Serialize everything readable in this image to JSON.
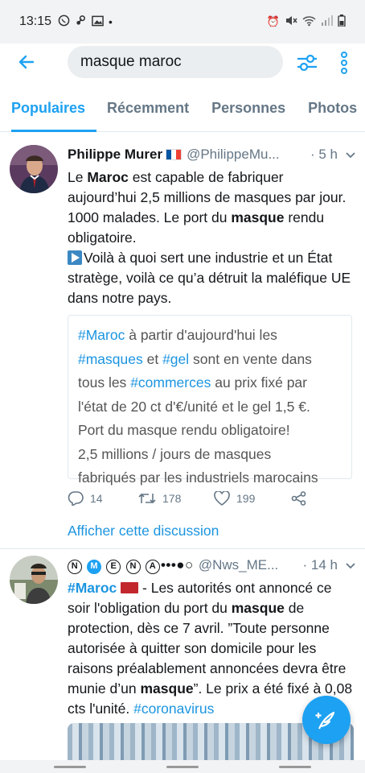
{
  "status_bar": {
    "time": "13:15",
    "left_icons": [
      "whatsapp-icon",
      "steam-icon",
      "gallery-icon",
      "dot-icon"
    ],
    "right_icons": [
      "alarm-icon",
      "mute-icon",
      "wifi-icon",
      "signal-icon",
      "battery-icon"
    ]
  },
  "search": {
    "query": "masque maroc",
    "back_icon": "back-arrow-icon",
    "filter_icon": "filter-icon",
    "more_icon": "more-vertical-icon"
  },
  "tabs": [
    {
      "label": "Populaires",
      "active": true
    },
    {
      "label": "Récemment",
      "active": false
    },
    {
      "label": "Personnes",
      "active": false
    },
    {
      "label": "Photos",
      "active": false
    }
  ],
  "tweets": [
    {
      "name": "Philippe Murer",
      "handle": "@PhilippeMu...",
      "time": "· 5 h",
      "text_parts": {
        "p1": "Le ",
        "b1": "Maroc",
        "p2": " est capable de fabriquer aujourd’hui 2,5 millions de masques par jour. 1000 malades. Le port du ",
        "b2": "masque",
        "p3": " rendu obligatoire.",
        "p4": "Voilà à quoi sert une industrie et un État stratège, voilà ce qu’a détruit la maléfique UE dans notre pays."
      },
      "quote_image_lines": [
        {
          "tag": "#Maroc",
          "text": " à partir d'aujourd'hui les"
        },
        {
          "tag": "#masques",
          "mid": " et ",
          "tag2": "#gel",
          "text": " sont en vente dans"
        },
        {
          "pre": "tous les ",
          "tag": "#commerces",
          "text": " au prix fixé par"
        },
        {
          "text": "l'état de 20 ct d'€/unité et le gel 1,5 €."
        },
        {
          "text": "Port du masque rendu obligatoire!"
        },
        {
          "text": "2,5 millions / jours de masques"
        },
        {
          "text": "fabriqués par les industriels marocains"
        }
      ],
      "replies": "14",
      "retweets": "178",
      "likes": "199",
      "show_thread": "Afficher cette discussion"
    },
    {
      "name_badges": [
        "N",
        "M",
        "E",
        "N",
        "A"
      ],
      "name_suffix": "•••●○",
      "handle": "@Nws_ME...",
      "time": "· 14 h",
      "text_parts": {
        "tag1": "#Maroc",
        "p1": " - Les autorités ont annoncé ce soir l'obligation du port du ",
        "b1": "masque",
        "p2": " de protection, dès ce 7 avril. ”Toute personne autorisée à quitter son domicile pour les raisons préalablement annoncées devra être munie d’un ",
        "b2": "masque",
        "p3": "”. Le prix a été fixé à 0,08 cts l'unité. ",
        "tag2": "#coronavirus"
      }
    }
  ],
  "fab_icon": "compose-tweet-icon",
  "colors": {
    "accent": "#1da1f2",
    "link": "#1b95e0",
    "secondary_text": "#657786"
  }
}
